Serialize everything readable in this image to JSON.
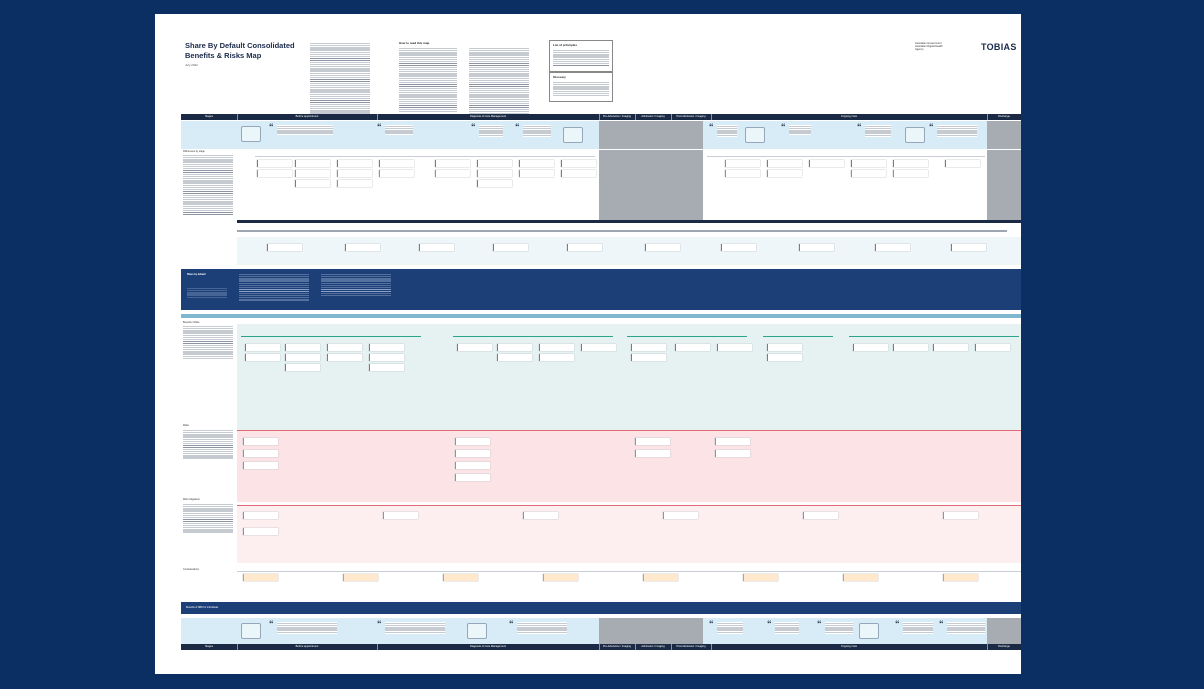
{
  "poster": {
    "title_line1": "Share By Default Consolidated",
    "title_line2": "Benefits & Risks Map",
    "date": "July 2022",
    "how_to_read": "How to read this map",
    "list_of_principles": "List of principles",
    "glossary": "Glossary",
    "logo_gov_lines": [
      "Australian Government",
      "Australian Digital Health",
      "Agency"
    ],
    "logo_tobias": "TOBIAS"
  },
  "top_band": {
    "labels": [
      "Stages",
      "Before appointment",
      "Diagnosis & Care Management",
      "Pre-Admission / Imaging",
      "Admission / Imaging",
      "Post Admission / Imaging",
      "Ongoing Care",
      "Discharge"
    ]
  },
  "sections": {
    "differences": "Differences by stage",
    "share_by_default": "Share by default",
    "benefits_risks": "Benefits / Risks",
    "risks": "Risks",
    "mitigations": "Risk mitigations",
    "considerations": "Considerations",
    "benefits_with_sbd": "Benefits of SBD for individuals"
  },
  "bottom_band": {
    "labels": [
      "Stages",
      "Before appointment",
      "Diagnosis & Care Management",
      "Pre-Admission / Imaging",
      "Admission / Imaging",
      "Post Admission / Imaging",
      "Ongoing Care",
      "Discharge"
    ]
  }
}
